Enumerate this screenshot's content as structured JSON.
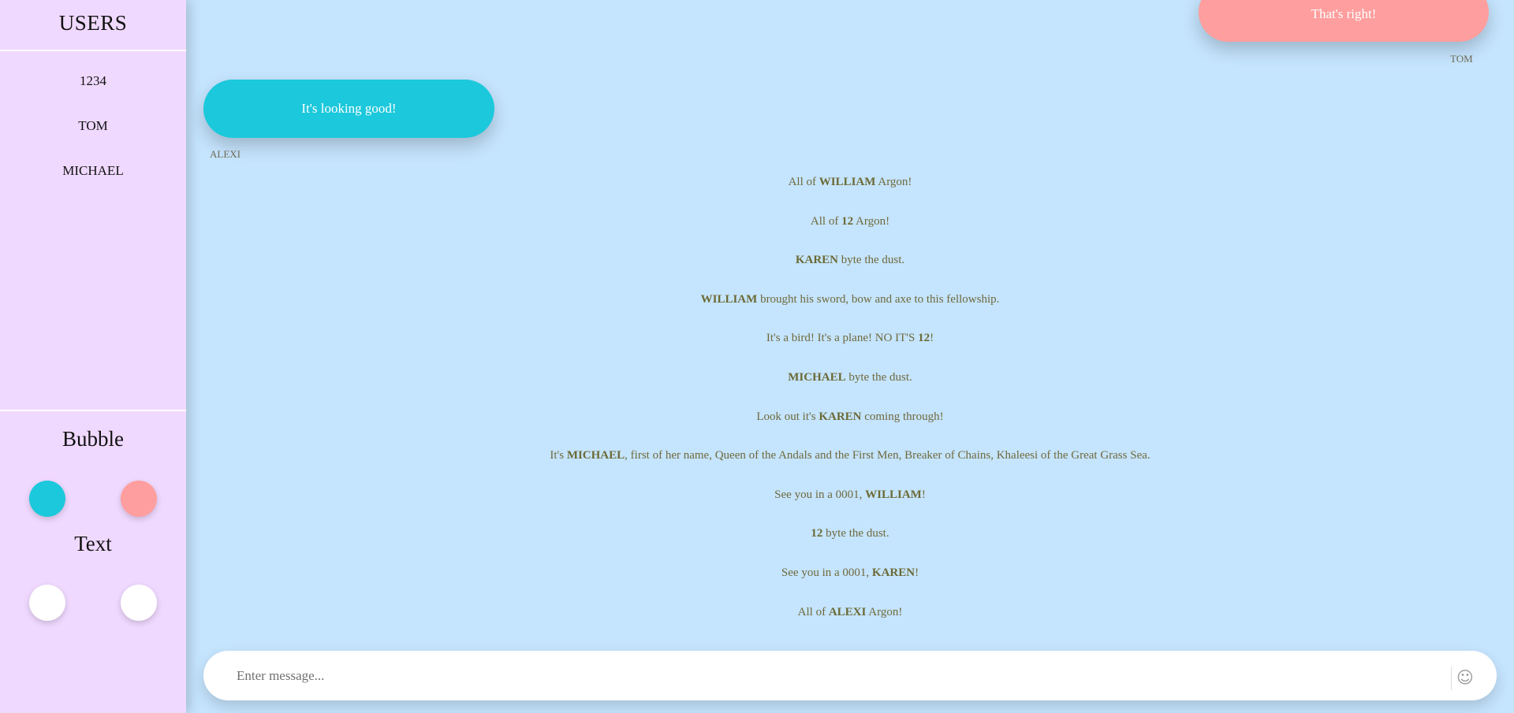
{
  "sidebar": {
    "title": "USERS",
    "users": [
      "1234",
      "TOM",
      "MICHAEL"
    ],
    "bubble_section_title": "Bubble",
    "text_section_title": "Text",
    "bubble_colors": [
      "#1cc8db",
      "#ff9e9e"
    ],
    "text_colors": [
      "#ffffff",
      "#ffffff"
    ]
  },
  "messages": [
    {
      "side": "right",
      "text": "That's right!",
      "sender": "TOM",
      "color": "#ff9e9e"
    },
    {
      "side": "left",
      "text": "It's looking good!",
      "sender": "ALEXI",
      "color": "#1cc8db"
    }
  ],
  "system_messages": [
    {
      "before": "All of ",
      "name": "WILLIAM",
      "after": " Argon!"
    },
    {
      "before": "All of ",
      "name": "12",
      "after": " Argon!"
    },
    {
      "before": "",
      "name": "KAREN",
      "after": " byte the dust."
    },
    {
      "before": "",
      "name": "WILLIAM",
      "after": " brought his sword, bow and axe to this fellowship."
    },
    {
      "before": "It's a bird! It's a plane! NO IT'S ",
      "name": "12",
      "after": "!"
    },
    {
      "before": "",
      "name": "MICHAEL",
      "after": " byte the dust."
    },
    {
      "before": "Look out it's ",
      "name": "KAREN",
      "after": " coming through!"
    },
    {
      "before": "It's ",
      "name": "MICHAEL",
      "after": ", first of her name, Queen of the Andals and the First Men, Breaker of Chains, Khaleesi of the Great Grass Sea."
    },
    {
      "before": "See you in a 0001, ",
      "name": "WILLIAM",
      "after": "!"
    },
    {
      "before": "",
      "name": "12",
      "after": " byte the dust."
    },
    {
      "before": "See you in a 0001, ",
      "name": "KAREN",
      "after": "!"
    },
    {
      "before": "All of ",
      "name": "ALEXI",
      "after": " Argon!"
    }
  ],
  "composer": {
    "placeholder": "Enter message...",
    "emoji_icon": "smiley-face-icon"
  }
}
